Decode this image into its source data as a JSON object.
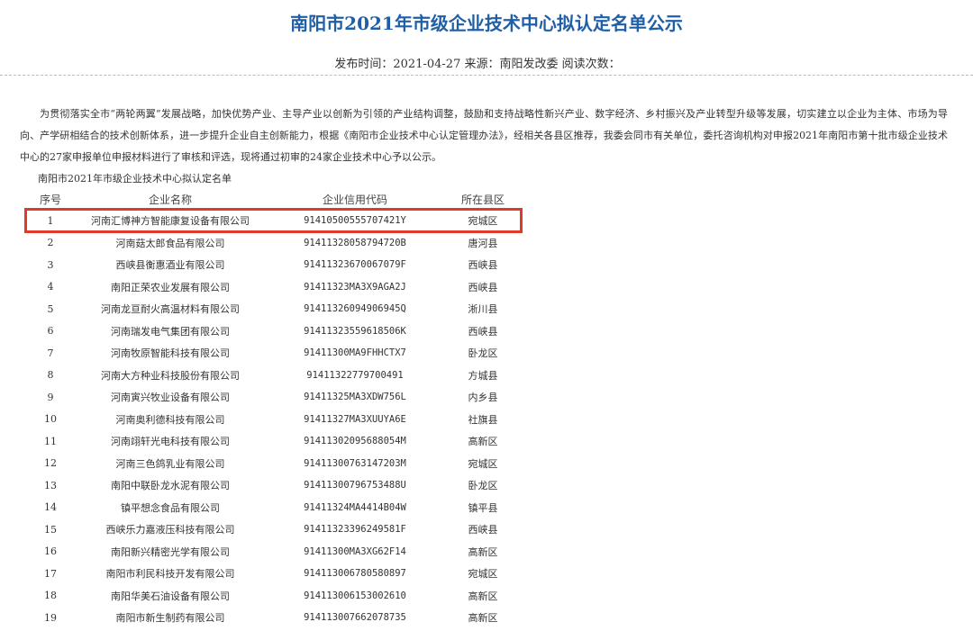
{
  "article": {
    "title": "南阳市2021年市级企业技术中心拟认定名单公示",
    "meta": "发布时间：2021-04-27 来源：南阳发改委 阅读次数：",
    "intro": "为贯彻落实全市“两轮两翼”发展战略，加快优势产业、主导产业以创新为引领的产业结构调整，鼓励和支持战略性新兴产业、数字经济、乡村振兴及产业转型升级等发展，切实建立以企业为主体、市场为导向、产学研相结合的技术创新体系，进一步提升企业自主创新能力，根据《南阳市企业技术中心认定管理办法》，经相关各县区推荐，我委会同市有关单位，委托咨询机构对申报2021年南阳市第十批市级企业技术中心的27家申报单位申报材料进行了审核和评选，现将通过初审的24家企业技术中心予以公示。"
  },
  "table": {
    "caption": "南阳市2021年市级企业技术中心拟认定名单",
    "headers": {
      "no": "序号",
      "name": "企业名称",
      "code": "企业信用代码",
      "county": "所在县区"
    },
    "rows": [
      {
        "no": "1",
        "name": "河南汇博神方智能康复设备有限公司",
        "code": "91410500555707421Y",
        "county": "宛城区"
      },
      {
        "no": "2",
        "name": "河南菇太郎食品有限公司",
        "code": "91411328058794720B",
        "county": "唐河县"
      },
      {
        "no": "3",
        "name": "西峡县衡惠酒业有限公司",
        "code": "91411323670067079F",
        "county": "西峡县"
      },
      {
        "no": "4",
        "name": "南阳正荣农业发展有限公司",
        "code": "91411323MA3X9AGA2J",
        "county": "西峡县"
      },
      {
        "no": "5",
        "name": "河南龙亘耐火高温材料有限公司",
        "code": "91411326094906945Q",
        "county": "淅川县"
      },
      {
        "no": "6",
        "name": "河南瑞发电气集团有限公司",
        "code": "91411323559618506K",
        "county": "西峡县"
      },
      {
        "no": "7",
        "name": "河南牧原智能科技有限公司",
        "code": "91411300MA9FHHCTX7",
        "county": "卧龙区"
      },
      {
        "no": "8",
        "name": "河南大方种业科技股份有限公司",
        "code": "91411322779700491",
        "county": "方城县"
      },
      {
        "no": "9",
        "name": "河南寅兴牧业设备有限公司",
        "code": "91411325MA3XDW756L",
        "county": "内乡县"
      },
      {
        "no": "10",
        "name": "河南奥利德科技有限公司",
        "code": "91411327MA3XUUYA6E",
        "county": "社旗县"
      },
      {
        "no": "11",
        "name": "河南翊轩光电科技有限公司",
        "code": "91411302095688054M",
        "county": "高新区"
      },
      {
        "no": "12",
        "name": "河南三色鸽乳业有限公司",
        "code": "91411300763147203M",
        "county": "宛城区"
      },
      {
        "no": "13",
        "name": "南阳中联卧龙水泥有限公司",
        "code": "91411300796753488U",
        "county": "卧龙区"
      },
      {
        "no": "14",
        "name": "镇平想念食品有限公司",
        "code": "91411324MA4414B04W",
        "county": "镇平县"
      },
      {
        "no": "15",
        "name": "西峡乐力嘉液压科技有限公司",
        "code": "91411323396249581F",
        "county": "西峡县"
      },
      {
        "no": "16",
        "name": "南阳新兴精密光学有限公司",
        "code": "91411300MA3XG62F14",
        "county": "高新区"
      },
      {
        "no": "17",
        "name": "南阳市利民科技开发有限公司",
        "code": "91411300678058089​7",
        "county": "宛城区"
      },
      {
        "no": "18",
        "name": "南阳华美石油设备有限公司",
        "code": "91411300615300261​0",
        "county": "高新区"
      },
      {
        "no": "19",
        "name": "南阳市新生制药有限公司",
        "code": "91411300766207873​5",
        "county": "高新区"
      }
    ]
  },
  "colors": {
    "title": "#1f5fa8",
    "highlight": "#e03a2a"
  }
}
